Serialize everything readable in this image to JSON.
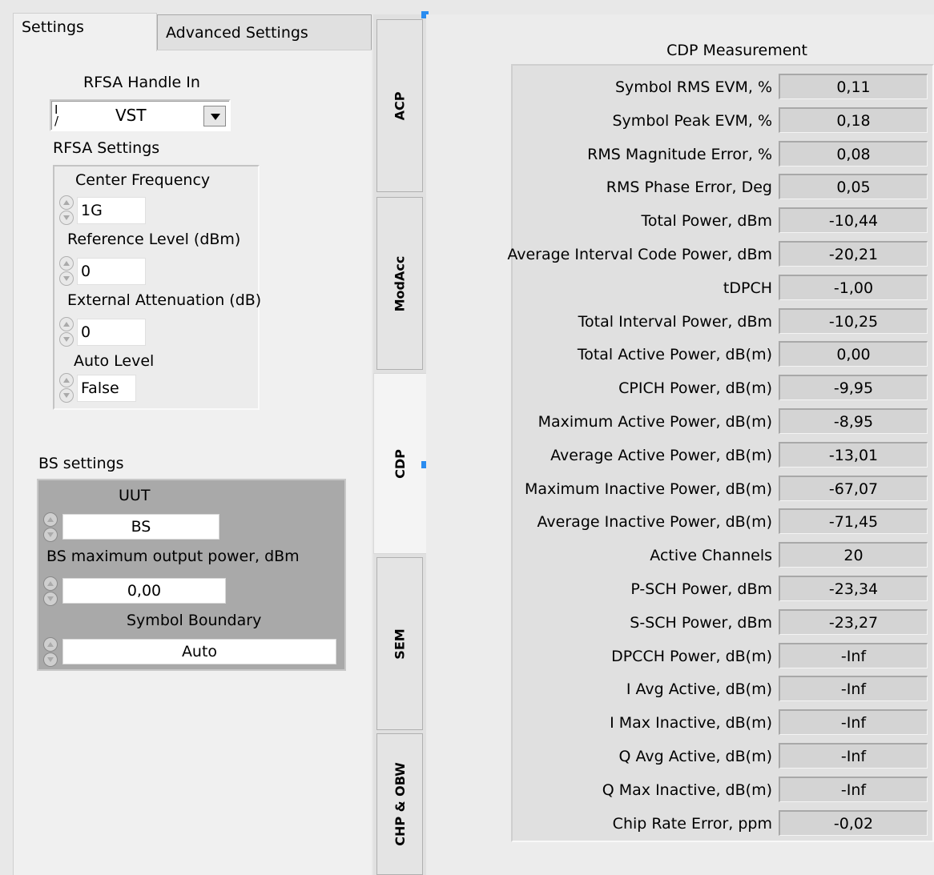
{
  "top_tabs": {
    "settings": "Settings",
    "advanced": "Advanced Settings"
  },
  "rfsa": {
    "handle_label": "RFSA Handle In",
    "handle_io": "I/O",
    "handle_value": "VST",
    "settings_label": "RFSA Settings",
    "center_frequency_label": "Center Frequency",
    "center_frequency_value": "1G",
    "reference_level_label": "Reference Level (dBm)",
    "reference_level_value": "0",
    "external_attenuation_label": "External Attenuation (dB)",
    "external_attenuation_value": "0",
    "auto_level_label": "Auto Level",
    "auto_level_value": "False"
  },
  "bs": {
    "settings_label": "BS settings",
    "uut_label": "UUT",
    "uut_value": "BS",
    "max_power_label": "BS maximum output power, dBm",
    "max_power_value": "0,00",
    "symbol_boundary_label": "Symbol Boundary",
    "symbol_boundary_value": "Auto"
  },
  "side_tabs": [
    "ACP",
    "ModAcc",
    "CDP",
    "SEM",
    "CHP & OBW"
  ],
  "cdp": {
    "title": "CDP Measurement",
    "rows": [
      {
        "label": "Symbol RMS EVM, %",
        "value": "0,11"
      },
      {
        "label": "Symbol Peak EVM, %",
        "value": "0,18"
      },
      {
        "label": "RMS Magnitude Error, %",
        "value": "0,08"
      },
      {
        "label": "RMS Phase Error, Deg",
        "value": "0,05"
      },
      {
        "label": "Total Power, dBm",
        "value": "-10,44"
      },
      {
        "label": "Average Interval Code Power, dBm",
        "value": "-20,21"
      },
      {
        "label": "tDPCH",
        "value": "-1,00"
      },
      {
        "label": "Total Interval Power, dBm",
        "value": "-10,25"
      },
      {
        "label": "Total Active Power, dB(m)",
        "value": "0,00"
      },
      {
        "label": "CPICH Power, dB(m)",
        "value": "-9,95"
      },
      {
        "label": "Maximum Active Power, dB(m)",
        "value": "-8,95"
      },
      {
        "label": "Average Active Power, dB(m)",
        "value": "-13,01"
      },
      {
        "label": "Maximum Inactive Power, dB(m)",
        "value": "-67,07"
      },
      {
        "label": "Average Inactive Power, dB(m)",
        "value": "-71,45"
      },
      {
        "label": "Active Channels",
        "value": "20"
      },
      {
        "label": "P-SCH Power, dBm",
        "value": "-23,34"
      },
      {
        "label": "S-SCH Power, dBm",
        "value": "-23,27"
      },
      {
        "label": "DPCCH Power, dB(m)",
        "value": "-Inf"
      },
      {
        "label": "I Avg Active, dB(m)",
        "value": "-Inf"
      },
      {
        "label": "I Max Inactive, dB(m)",
        "value": "-Inf"
      },
      {
        "label": "Q Avg Active, dB(m)",
        "value": "-Inf"
      },
      {
        "label": "Q Max Inactive, dB(m)",
        "value": "-Inf"
      },
      {
        "label": "Chip Rate Error, ppm",
        "value": "-0,02"
      }
    ]
  }
}
